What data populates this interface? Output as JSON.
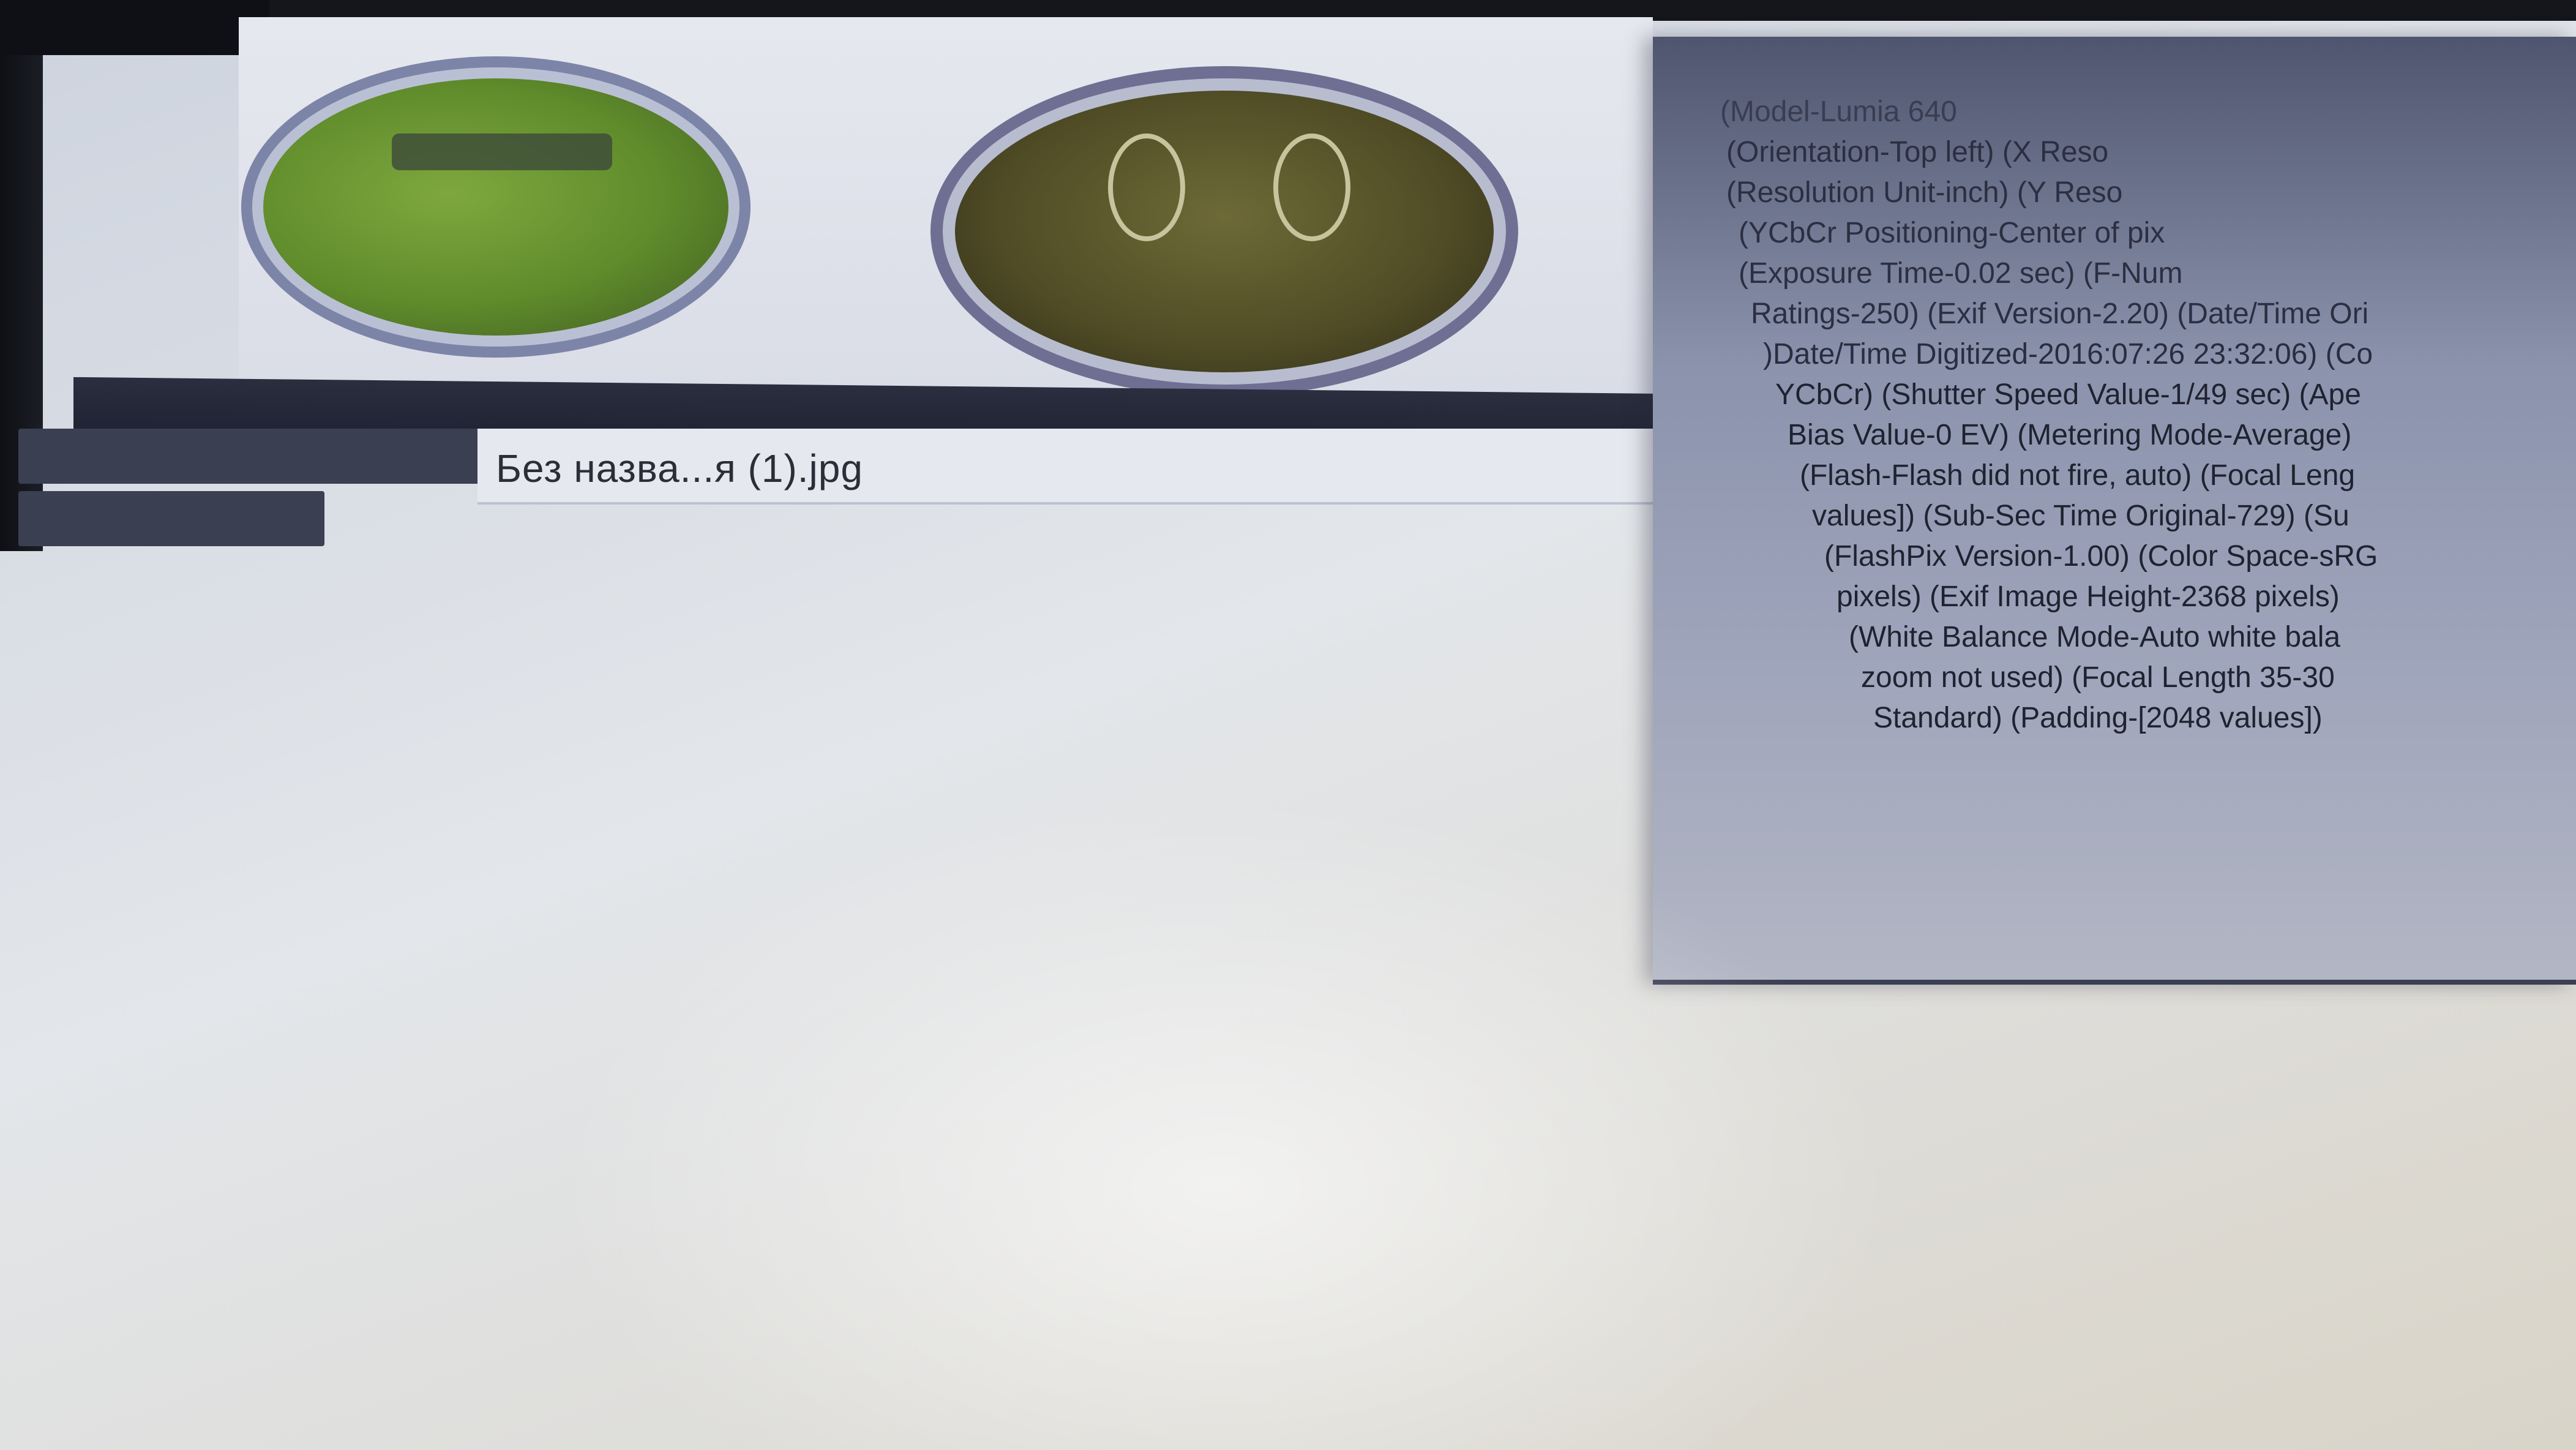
{
  "file_tab": {
    "filename": "Без назва...я (1).jpg"
  },
  "side_list": {
    "items": [
      {
        "label": ""
      },
      {
        "label": ""
      }
    ]
  },
  "thumbnails": [
    {
      "icon": "image-thumbnail"
    },
    {
      "icon": "image-thumbnail"
    }
  ],
  "metadata": {
    "lines": [
      "(Model-Lumia 640",
      "(Orientation-Top left) (X Reso",
      "(Resolution Unit-inch) (Y Reso",
      "(YCbCr Positioning-Center of pix",
      "(Exposure Time-0.02 sec) (F-Num",
      "Ratings-250) (Exif Version-2.20) (Date/Time Ori",
      ")Date/Time Digitized-2016:07:26 23:32:06) (Co",
      "YCbCr) (Shutter Speed Value-1/49 sec) (Ape",
      "Bias Value-0 EV) (Metering Mode-Average)",
      "(Flash-Flash did not fire, auto) (Focal Leng",
      "values]) (Sub-Sec Time Original-729) (Su",
      "(FlashPix Version-1.00) (Color Space-sRG",
      "pixels) (Exif Image Height-2368 pixels)",
      "(White Balance Mode-Auto white bala",
      "zoom not used) (Focal Length 35-30",
      "Standard) (Padding-[2048 values])"
    ]
  }
}
